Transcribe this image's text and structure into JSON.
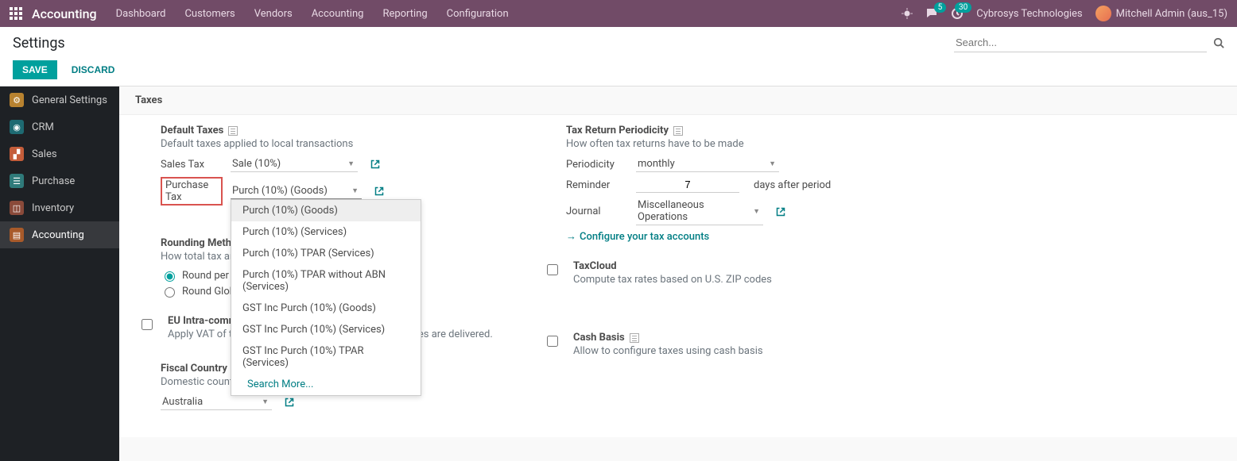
{
  "nav": {
    "brand": "Accounting",
    "menu": [
      "Dashboard",
      "Customers",
      "Vendors",
      "Accounting",
      "Reporting",
      "Configuration"
    ],
    "msg_badge": "5",
    "act_badge": "30",
    "company": "Cybrosys Technologies",
    "user": "Mitchell Admin (aus_15)"
  },
  "cp": {
    "title": "Settings",
    "search_placeholder": "Search...",
    "save": "SAVE",
    "discard": "DISCARD"
  },
  "sidebar": {
    "items": [
      {
        "label": "General Settings",
        "color": "#b88230"
      },
      {
        "label": "CRM",
        "color": "#1e6a72"
      },
      {
        "label": "Sales",
        "color": "#c45d3a"
      },
      {
        "label": "Purchase",
        "color": "#2f7a7a"
      },
      {
        "label": "Inventory",
        "color": "#8a4a3a"
      },
      {
        "label": "Accounting",
        "color": "#a85a2a"
      }
    ]
  },
  "section_header": "Taxes",
  "default_taxes": {
    "title": "Default Taxes",
    "desc": "Default taxes applied to local transactions",
    "sales_label": "Sales Tax",
    "sales_value": "Sale (10%)",
    "purchase_label": "Purchase Tax",
    "purchase_value": "Purch (10%) (Goods)",
    "dropdown": [
      "Purch (10%) (Goods)",
      "Purch (10%) (Services)",
      "Purch (10%) TPAR (Services)",
      "Purch (10%) TPAR without ABN (Services)",
      "GST Inc Purch (10%) (Goods)",
      "GST Inc Purch (10%) (Services)",
      "GST Inc Purch (10%) TPAR (Services)"
    ],
    "search_more": "Search More..."
  },
  "rounding": {
    "title": "Rounding Method",
    "desc": "How total tax am",
    "opt1": "Round per Lin",
    "opt2": "Round Globall"
  },
  "eu": {
    "title": "EU Intra-community Distance Selling",
    "desc": "Apply VAT of the EU country to which goods and services are delivered."
  },
  "fiscal": {
    "title": "Fiscal Country",
    "desc": "Domestic country of your accounting",
    "value": "Australia"
  },
  "periodicity": {
    "title": "Tax Return Periodicity",
    "desc": "How often tax returns have to be made",
    "period_label": "Periodicity",
    "period_value": "monthly",
    "reminder_label": "Reminder",
    "reminder_value": "7",
    "reminder_after": "days after period",
    "journal_label": "Journal",
    "journal_value": "Miscellaneous Operations",
    "configure": "Configure your tax accounts"
  },
  "taxcloud": {
    "title": "TaxCloud",
    "desc": "Compute tax rates based on U.S. ZIP codes"
  },
  "cashbasis": {
    "title": "Cash Basis",
    "desc": "Allow to configure taxes using cash basis"
  }
}
